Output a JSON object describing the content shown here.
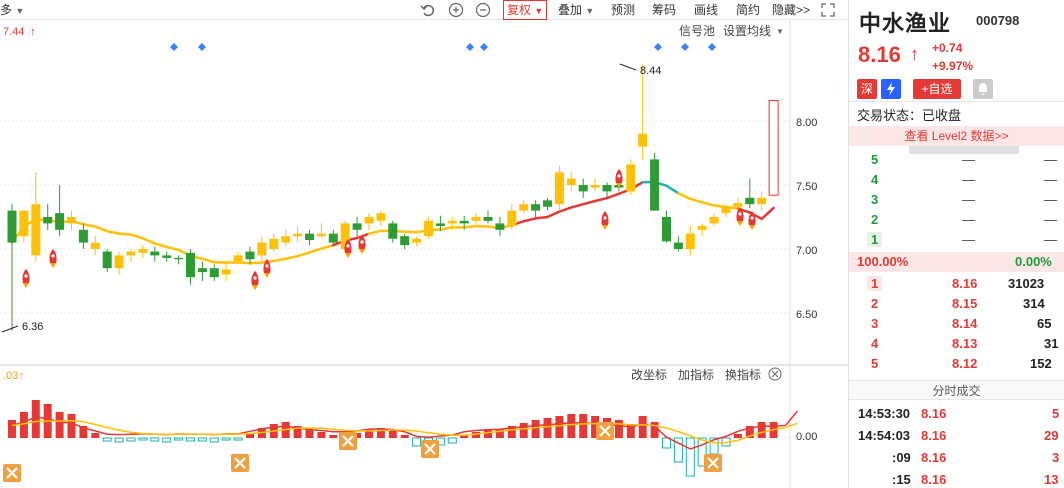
{
  "toolbar": {
    "left_label": "多",
    "items": [
      "复权",
      "叠加",
      "预测",
      "筹码",
      "画线",
      "简约",
      "隐藏>>"
    ]
  },
  "chart": {
    "max_label": "7.44",
    "high_annot": "8.44",
    "low_annot": "6.36",
    "signal_label": "信号池",
    "ma_label": "设置均线",
    "y_ticks": [
      "8.00",
      "7.50",
      "7.00",
      "6.50"
    ],
    "sub_label": ".03",
    "sub_tick": "0.00",
    "sub_buttons": [
      "改坐标",
      "加指标",
      "换指标"
    ],
    "colors": {
      "up": "#ffc107",
      "down": "#2e9b35",
      "ma": "#ffc107",
      "ma_red": "#e53935",
      "ma_teal": "#20b2aa",
      "vol_up": "#e53935",
      "vol_down": "#20b2aa"
    }
  },
  "stock": {
    "name": "中水渔业",
    "code": "000798",
    "price": "8.16",
    "arrow": "↑",
    "change": "+0.74",
    "change_pct": "+9.97%",
    "badges": [
      "深",
      "+自选"
    ],
    "status": "交易状态：已收盘",
    "level2": "查看 Level2 数据>>"
  },
  "asks": [
    {
      "level": "5",
      "price": "—",
      "vol": "—"
    },
    {
      "level": "4",
      "price": "—",
      "vol": "—"
    },
    {
      "level": "3",
      "price": "—",
      "vol": "—"
    },
    {
      "level": "2",
      "price": "—",
      "vol": "—"
    },
    {
      "level": "1",
      "price": "—",
      "vol": "—"
    }
  ],
  "ratio": {
    "left": "100.00%",
    "right": "0.00%"
  },
  "bids": [
    {
      "level": "1",
      "price": "8.16",
      "vol": "31023"
    },
    {
      "level": "2",
      "price": "8.15",
      "vol": "314"
    },
    {
      "level": "3",
      "price": "8.14",
      "vol": "65"
    },
    {
      "level": "4",
      "price": "8.13",
      "vol": "31"
    },
    {
      "level": "5",
      "price": "8.12",
      "vol": "152"
    }
  ],
  "ticks_title": "分时成交",
  "ticks": [
    {
      "time": "14:53:30",
      "price": "8.16",
      "vol": "5"
    },
    {
      "time": "14:54:03",
      "price": "8.16",
      "vol": "29"
    },
    {
      "time": ":09",
      "price": "8.16",
      "vol": "3"
    },
    {
      "time": ":15",
      "price": "8.16",
      "vol": "13"
    }
  ],
  "chart_data": {
    "type": "candlestick",
    "y_ticks": [
      8.0,
      7.5,
      7.0,
      6.5
    ],
    "annotations": [
      {
        "label": "8.44"
      },
      {
        "label": "6.36"
      }
    ],
    "candles": [
      {
        "o": 7.3,
        "c": 7.05,
        "h": 7.35,
        "l": 6.36
      },
      {
        "o": 7.1,
        "c": 7.3,
        "h": 7.3,
        "l": 7.05
      },
      {
        "o": 6.95,
        "c": 7.35,
        "h": 7.6,
        "l": 6.9
      },
      {
        "o": 7.25,
        "c": 7.2,
        "h": 7.35,
        "l": 7.15
      },
      {
        "o": 7.28,
        "c": 7.15,
        "h": 7.5,
        "l": 7.1
      },
      {
        "o": 7.2,
        "c": 7.25,
        "h": 7.3,
        "l": 7.15
      },
      {
        "o": 7.15,
        "c": 7.05,
        "h": 7.2,
        "l": 7.0
      },
      {
        "o": 7.0,
        "c": 7.05,
        "h": 7.1,
        "l": 6.95
      },
      {
        "o": 6.98,
        "c": 6.85,
        "h": 7.0,
        "l": 6.82
      },
      {
        "o": 6.85,
        "c": 6.95,
        "h": 6.98,
        "l": 6.8
      },
      {
        "o": 6.95,
        "c": 6.98,
        "h": 7.0,
        "l": 6.9
      },
      {
        "o": 6.97,
        "c": 7.0,
        "h": 7.03,
        "l": 6.93
      },
      {
        "o": 6.98,
        "c": 6.95,
        "h": 7.02,
        "l": 6.9
      },
      {
        "o": 6.95,
        "c": 6.93,
        "h": 6.98,
        "l": 6.9
      },
      {
        "o": 6.93,
        "c": 6.92,
        "h": 6.95,
        "l": 6.88
      },
      {
        "o": 6.97,
        "c": 6.78,
        "h": 7.0,
        "l": 6.72
      },
      {
        "o": 6.85,
        "c": 6.82,
        "h": 6.9,
        "l": 6.75
      },
      {
        "o": 6.85,
        "c": 6.78,
        "h": 6.88,
        "l": 6.75
      },
      {
        "o": 6.8,
        "c": 6.84,
        "h": 6.88,
        "l": 6.75
      },
      {
        "o": 6.9,
        "c": 6.95,
        "h": 6.98,
        "l": 6.88
      },
      {
        "o": 6.98,
        "c": 6.92,
        "h": 7.02,
        "l": 6.88
      },
      {
        "o": 6.95,
        "c": 7.05,
        "h": 7.1,
        "l": 6.9
      },
      {
        "o": 7.0,
        "c": 7.08,
        "h": 7.12,
        "l": 6.98
      },
      {
        "o": 7.05,
        "c": 7.1,
        "h": 7.15,
        "l": 7.02
      },
      {
        "o": 7.1,
        "c": 7.12,
        "h": 7.18,
        "l": 7.05
      },
      {
        "o": 7.12,
        "c": 7.07,
        "h": 7.15,
        "l": 7.03
      },
      {
        "o": 7.1,
        "c": 7.12,
        "h": 7.2,
        "l": 7.08
      },
      {
        "o": 7.12,
        "c": 7.05,
        "h": 7.15,
        "l": 7.02
      },
      {
        "o": 7.0,
        "c": 7.2,
        "h": 7.22,
        "l": 6.98
      },
      {
        "o": 7.2,
        "c": 7.15,
        "h": 7.25,
        "l": 7.1
      },
      {
        "o": 7.2,
        "c": 7.25,
        "h": 7.28,
        "l": 7.15
      },
      {
        "o": 7.22,
        "c": 7.28,
        "h": 7.3,
        "l": 7.18
      },
      {
        "o": 7.2,
        "c": 7.08,
        "h": 7.22,
        "l": 7.05
      },
      {
        "o": 7.1,
        "c": 7.03,
        "h": 7.12,
        "l": 7.0
      },
      {
        "o": 7.05,
        "c": 7.08,
        "h": 7.1,
        "l": 7.02
      },
      {
        "o": 7.1,
        "c": 7.22,
        "h": 7.25,
        "l": 7.08
      },
      {
        "o": 7.2,
        "c": 7.18,
        "h": 7.26,
        "l": 7.14
      },
      {
        "o": 7.2,
        "c": 7.22,
        "h": 7.25,
        "l": 7.15
      },
      {
        "o": 7.22,
        "c": 7.2,
        "h": 7.26,
        "l": 7.15
      },
      {
        "o": 7.22,
        "c": 7.25,
        "h": 7.28,
        "l": 7.18
      },
      {
        "o": 7.25,
        "c": 7.22,
        "h": 7.3,
        "l": 7.2
      },
      {
        "o": 7.2,
        "c": 7.15,
        "h": 7.25,
        "l": 7.1
      },
      {
        "o": 7.18,
        "c": 7.3,
        "h": 7.35,
        "l": 7.15
      },
      {
        "o": 7.3,
        "c": 7.35,
        "h": 7.38,
        "l": 7.28
      },
      {
        "o": 7.35,
        "c": 7.3,
        "h": 7.38,
        "l": 7.25
      },
      {
        "o": 7.38,
        "c": 7.33,
        "h": 7.4,
        "l": 7.3
      },
      {
        "o": 7.35,
        "c": 7.6,
        "h": 7.65,
        "l": 7.3
      },
      {
        "o": 7.5,
        "c": 7.55,
        "h": 7.6,
        "l": 7.45
      },
      {
        "o": 7.5,
        "c": 7.45,
        "h": 7.55,
        "l": 7.4
      },
      {
        "o": 7.48,
        "c": 7.5,
        "h": 7.55,
        "l": 7.45
      },
      {
        "o": 7.5,
        "c": 7.45,
        "h": 7.52,
        "l": 7.4
      },
      {
        "o": 7.5,
        "c": 7.48,
        "h": 7.52,
        "l": 7.45
      },
      {
        "o": 7.45,
        "c": 7.66,
        "h": 7.7,
        "l": 7.42
      },
      {
        "o": 7.8,
        "c": 7.9,
        "h": 8.44,
        "l": 7.7
      },
      {
        "o": 7.7,
        "c": 7.3,
        "h": 7.75,
        "l": 7.3
      },
      {
        "o": 7.25,
        "c": 7.06,
        "h": 7.3,
        "l": 7.05
      },
      {
        "o": 7.05,
        "c": 7.0,
        "h": 7.1,
        "l": 6.98
      },
      {
        "o": 7.0,
        "c": 7.12,
        "h": 7.18,
        "l": 6.95
      },
      {
        "o": 7.15,
        "c": 7.18,
        "h": 7.2,
        "l": 7.1
      },
      {
        "o": 7.2,
        "c": 7.25,
        "h": 7.28,
        "l": 7.18
      },
      {
        "o": 7.28,
        "c": 7.33,
        "h": 7.35,
        "l": 7.25
      },
      {
        "o": 7.33,
        "c": 7.36,
        "h": 7.4,
        "l": 7.3
      },
      {
        "o": 7.4,
        "c": 7.35,
        "h": 7.55,
        "l": 7.32
      },
      {
        "o": 7.35,
        "c": 7.4,
        "h": 7.45,
        "l": 7.3
      },
      {
        "o": 7.42,
        "c": 8.16,
        "h": 8.16,
        "l": 7.42
      }
    ]
  }
}
